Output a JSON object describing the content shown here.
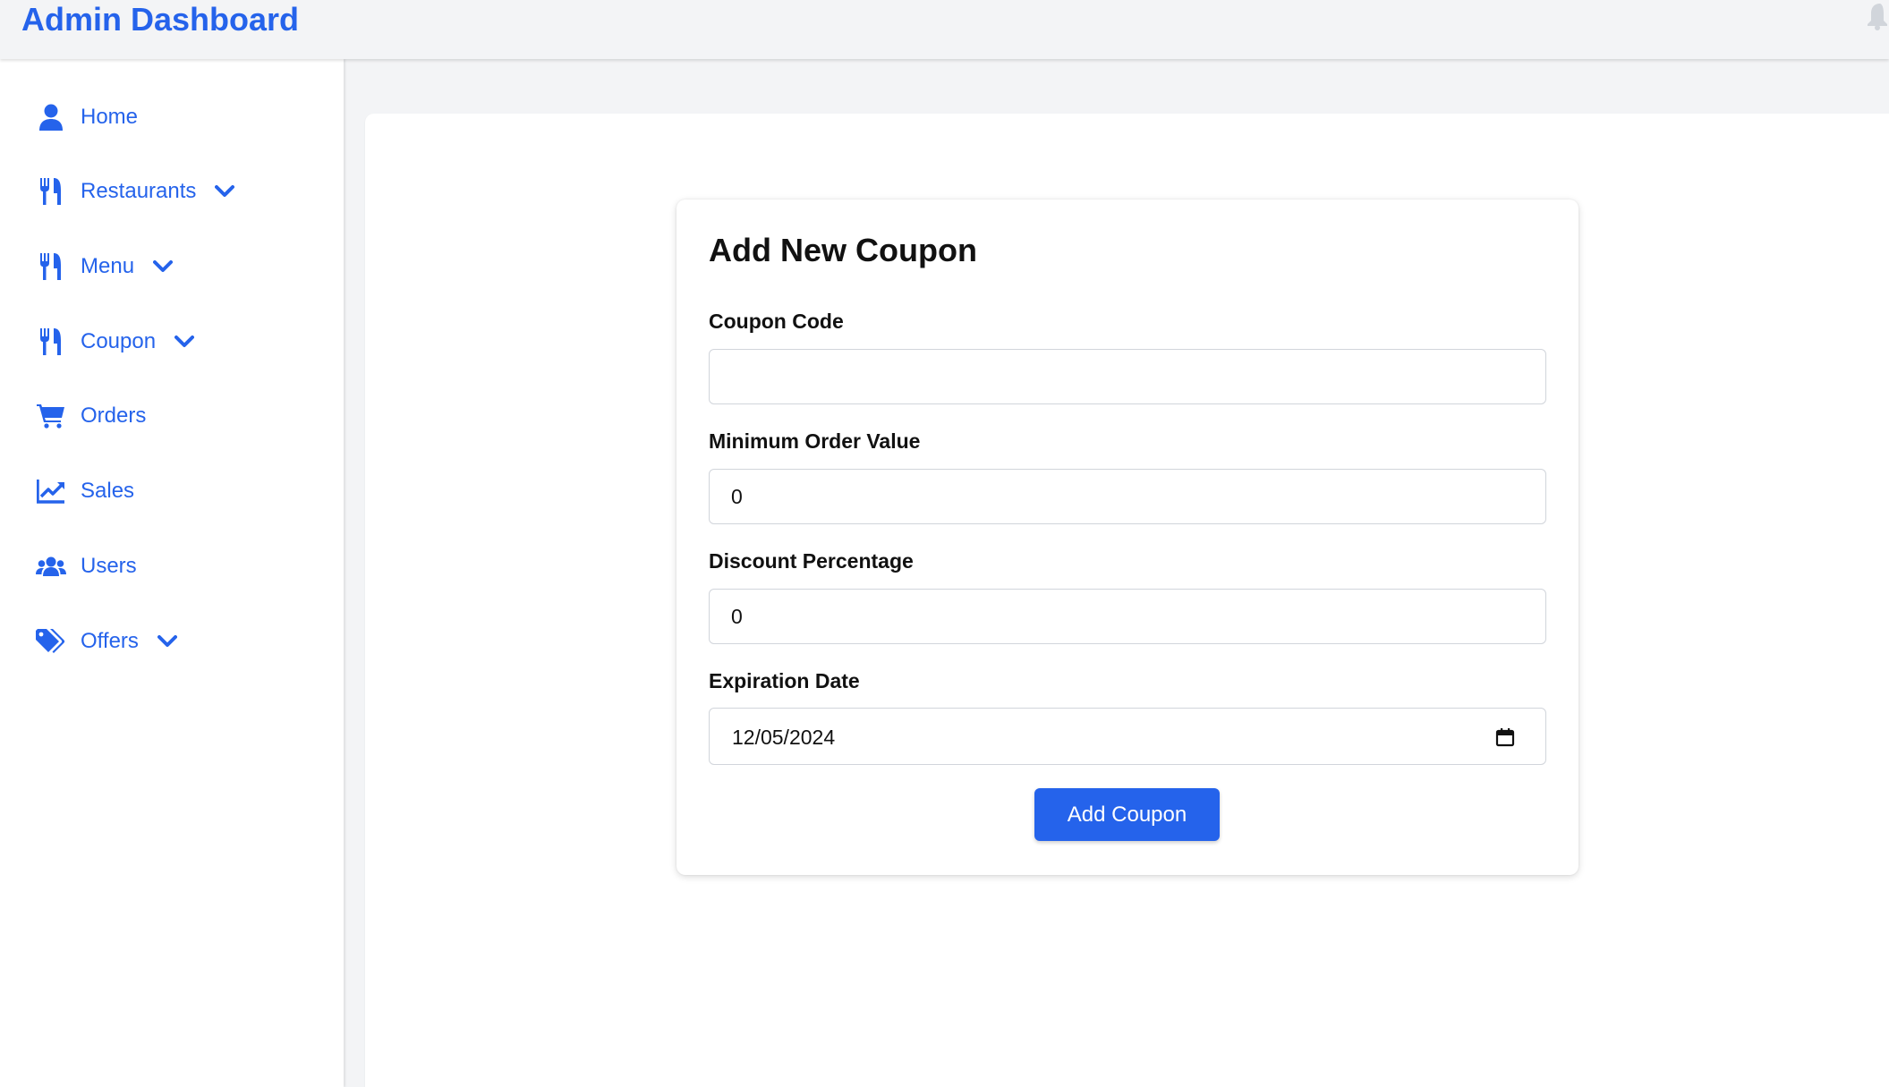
{
  "header": {
    "title": "Admin Dashboard",
    "bell_icon": "bell-icon"
  },
  "sidebar": {
    "items": [
      {
        "label": "Home",
        "icon": "user-icon",
        "has_dropdown": false
      },
      {
        "label": "Restaurants",
        "icon": "utensils-icon",
        "has_dropdown": true
      },
      {
        "label": "Menu",
        "icon": "utensils-icon",
        "has_dropdown": true
      },
      {
        "label": "Coupon",
        "icon": "utensils-icon",
        "has_dropdown": true
      },
      {
        "label": "Orders",
        "icon": "shopping-cart-icon",
        "has_dropdown": false
      },
      {
        "label": "Sales",
        "icon": "chart-line-icon",
        "has_dropdown": false
      },
      {
        "label": "Users",
        "icon": "users-icon",
        "has_dropdown": false
      },
      {
        "label": "Offers",
        "icon": "tags-icon",
        "has_dropdown": true
      }
    ]
  },
  "form": {
    "title": "Add New Coupon",
    "coupon_code": {
      "label": "Coupon Code",
      "value": "",
      "placeholder": ""
    },
    "min_order": {
      "label": "Minimum Order Value",
      "value": "0"
    },
    "discount": {
      "label": "Discount Percentage",
      "value": "0"
    },
    "expiration": {
      "label": "Expiration Date",
      "value": "12/05/2024"
    },
    "submit_label": "Add Coupon"
  },
  "colors": {
    "accent": "#2563eb",
    "background": "#f3f4f6",
    "card": "#ffffff",
    "text": "#111111"
  }
}
